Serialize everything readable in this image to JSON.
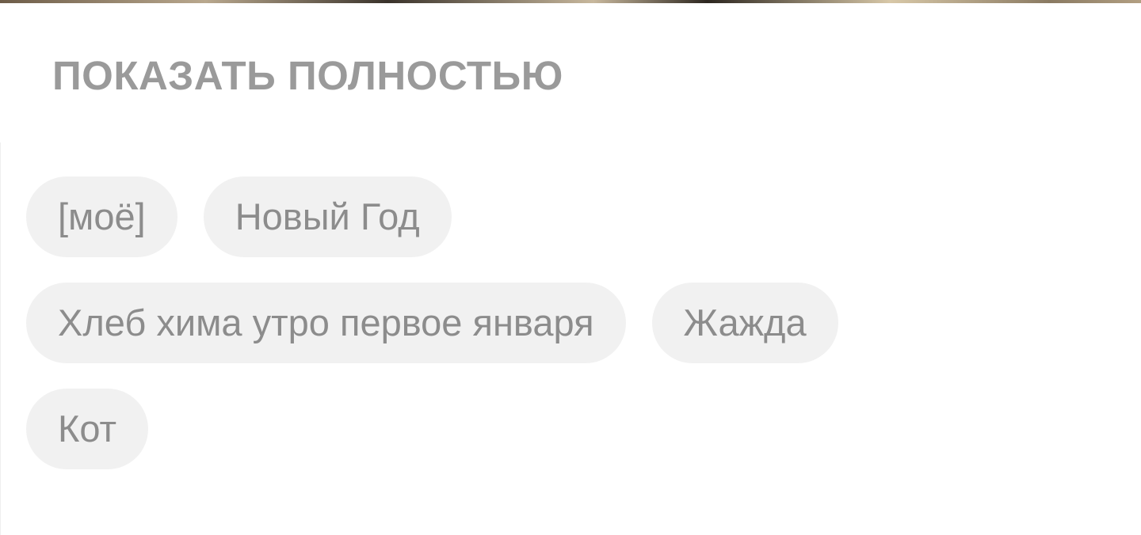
{
  "header": {
    "show_more_label": "ПОКАЗАТЬ ПОЛНОСТЬЮ"
  },
  "tags": {
    "rows": [
      [
        "[моё]",
        "Новый Год"
      ],
      [
        "Хлеб хима утро первое января",
        "Жажда"
      ],
      [
        "Кот"
      ]
    ]
  },
  "colors": {
    "show_more_text": "#9a9a9a",
    "tag_background": "#f1f1f1",
    "tag_text": "#8c8c8c",
    "page_background": "#ffffff"
  }
}
